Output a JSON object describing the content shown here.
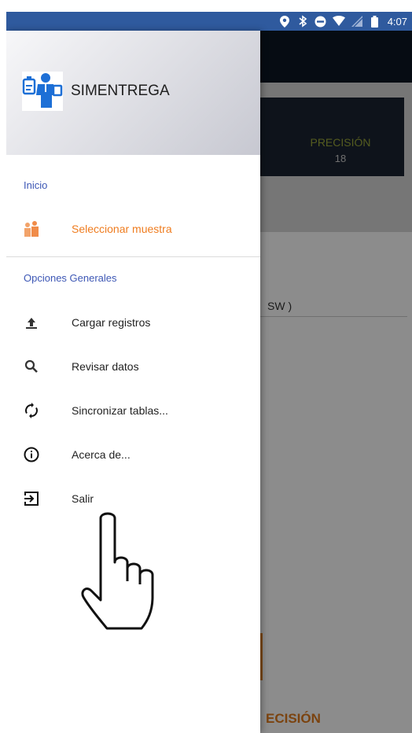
{
  "status_bar": {
    "time": "4:07"
  },
  "drawer": {
    "app_name": "SIMENTREGA",
    "sections": [
      {
        "label": "Inicio"
      },
      {
        "label": "Opciones Generales"
      }
    ],
    "items": [
      {
        "label": "Seleccionar muestra",
        "icon": "workers-icon",
        "active": true
      },
      {
        "label": "Cargar registros",
        "icon": "upload-icon"
      },
      {
        "label": "Revisar datos",
        "icon": "search-icon"
      },
      {
        "label": "Sincronizar tablas...",
        "icon": "sync-icon"
      },
      {
        "label": "Acerca de...",
        "icon": "info-icon"
      },
      {
        "label": "Salir",
        "icon": "exit-icon"
      }
    ]
  },
  "background": {
    "precision_label": "PRECISIÓN",
    "precision_value": "18",
    "row_text": "SW )",
    "bottom_text": "ECISIÓN"
  },
  "colors": {
    "accent": "#ef7c1f",
    "section": "#3d57b5",
    "statusbar": "#2f5a9e"
  }
}
